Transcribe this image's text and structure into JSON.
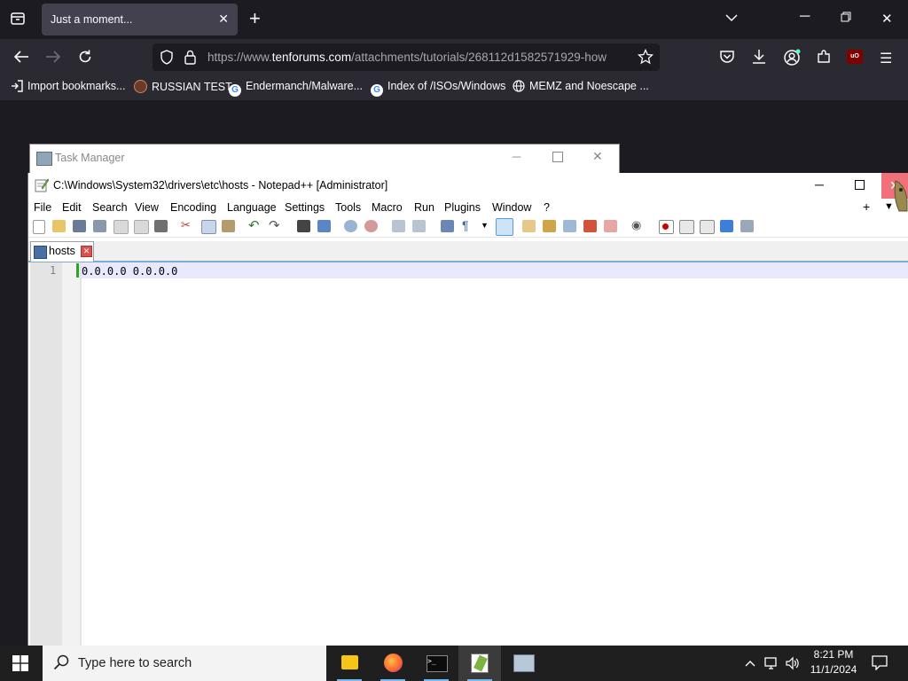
{
  "browser": {
    "tab_title": "Just a moment...",
    "url_prefix": "https://www.",
    "url_domain": "tenforums.com",
    "url_path": "/attachments/tutorials/268112d1582571929-how",
    "bookmarks": [
      {
        "label": "Import bookmarks...",
        "icon": "import-icon"
      },
      {
        "label": "RUSSIAN TEST",
        "icon": "favicon-icon"
      },
      {
        "label": "Endermanch/Malware...",
        "icon": "google-icon"
      },
      {
        "label": "Index of /ISOs/Windows",
        "icon": "google-icon"
      },
      {
        "label": "MEMZ and Noescape ...",
        "icon": "globe-icon"
      }
    ]
  },
  "task_manager": {
    "title": "Task Manager"
  },
  "notepad": {
    "title": "C:\\Windows\\System32\\drivers\\etc\\hosts - Notepad++ [Administrator]",
    "menu": [
      "File",
      "Edit",
      "Search",
      "View",
      "Encoding",
      "Language",
      "Settings",
      "Tools",
      "Macro",
      "Run",
      "Plugins",
      "Window",
      "?"
    ],
    "menu_plus": "+",
    "menu_arrow": "▼",
    "tab_label": "hosts",
    "line_number": "1",
    "line_text": "0.0.0.0 0.0.0.0"
  },
  "taskbar": {
    "search_placeholder": "Type here to search",
    "time": "8:21 PM",
    "date": "11/1/2024"
  },
  "colors": {
    "browser_bg": "#1c1b22",
    "toolbar_bg": "#2b2a33",
    "taskbar_bg": "#1f1f1f",
    "accent": "#76b9ed"
  }
}
